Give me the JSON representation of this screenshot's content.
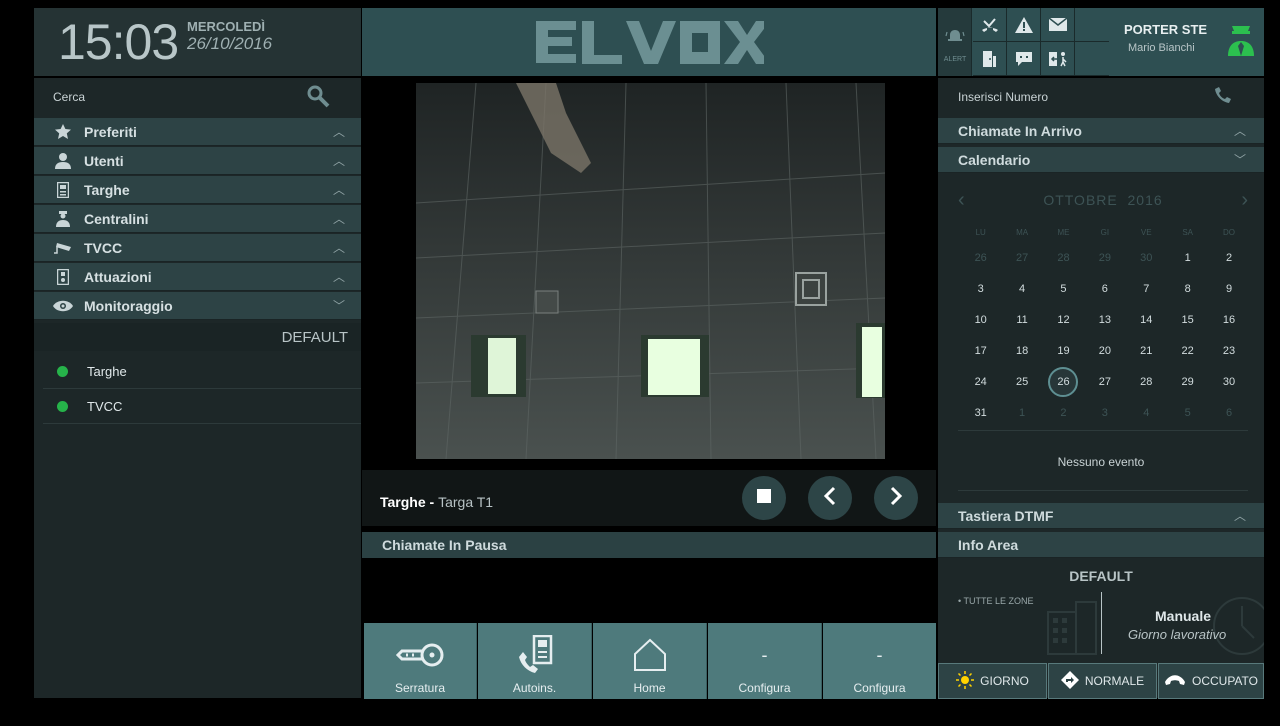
{
  "header": {
    "time": "15:03",
    "day": "MERCOLEDÌ",
    "date": "26/10/2016",
    "logo": "ELVOX",
    "alert_label": "ALERT",
    "role": "PORTER STE",
    "user": "Mario Bianchi"
  },
  "left": {
    "search_placeholder": "Cerca",
    "sections": [
      {
        "label": "Preferiti",
        "icon": "star-icon"
      },
      {
        "label": "Utenti",
        "icon": "user-icon"
      },
      {
        "label": "Targhe",
        "icon": "door-panel-icon"
      },
      {
        "label": "Centralini",
        "icon": "operator-icon"
      },
      {
        "label": "TVCC",
        "icon": "cctv-icon"
      },
      {
        "label": "Attuazioni",
        "icon": "switch-icon"
      },
      {
        "label": "Monitoraggio",
        "icon": "eye-icon"
      }
    ],
    "monitor_group": "DEFAULT",
    "monitor_items": [
      {
        "label": "Targhe",
        "status_color": "#26b34a"
      },
      {
        "label": "TVCC",
        "status_color": "#26b34a"
      }
    ]
  },
  "center": {
    "video_source": "Targhe",
    "video_separator": " - ",
    "video_target": "Targa T1",
    "paused_calls_title": "Chiamate In Pausa",
    "toolbar": [
      {
        "label": "Serratura",
        "icon": "key-icon"
      },
      {
        "label": "Autoins.",
        "icon": "intercom-call-icon"
      },
      {
        "label": "Home",
        "icon": "home-icon"
      },
      {
        "label": "Configura",
        "icon": "-"
      },
      {
        "label": "Configura",
        "icon": "-"
      }
    ]
  },
  "right": {
    "number_placeholder": "Inserisci Numero",
    "incoming_title": "Chiamate In Arrivo",
    "calendar_title": "Calendario",
    "calendar_month": "OTTOBRE",
    "calendar_year": "2016",
    "weekdays": [
      "LU",
      "MA",
      "ME",
      "GI",
      "VE",
      "SA",
      "DO"
    ],
    "days": [
      [
        "26",
        "o"
      ],
      [
        "27",
        "o"
      ],
      [
        "28",
        "o"
      ],
      [
        "29",
        "o"
      ],
      [
        "30",
        "o"
      ],
      [
        "1",
        "c"
      ],
      [
        "2",
        "c"
      ],
      [
        "3",
        "c"
      ],
      [
        "4",
        "c"
      ],
      [
        "5",
        "c"
      ],
      [
        "6",
        "c"
      ],
      [
        "7",
        "c"
      ],
      [
        "8",
        "c"
      ],
      [
        "9",
        "c"
      ],
      [
        "10",
        "c"
      ],
      [
        "11",
        "c"
      ],
      [
        "12",
        "c"
      ],
      [
        "13",
        "c"
      ],
      [
        "14",
        "c"
      ],
      [
        "15",
        "c"
      ],
      [
        "16",
        "c"
      ],
      [
        "17",
        "c"
      ],
      [
        "18",
        "c"
      ],
      [
        "19",
        "c"
      ],
      [
        "20",
        "c"
      ],
      [
        "21",
        "c"
      ],
      [
        "22",
        "c"
      ],
      [
        "23",
        "c"
      ],
      [
        "24",
        "c"
      ],
      [
        "25",
        "c"
      ],
      [
        "26",
        "t"
      ],
      [
        "27",
        "c"
      ],
      [
        "28",
        "c"
      ],
      [
        "29",
        "c"
      ],
      [
        "30",
        "c"
      ],
      [
        "31",
        "c"
      ],
      [
        "1",
        "o"
      ],
      [
        "2",
        "o"
      ],
      [
        "3",
        "o"
      ],
      [
        "4",
        "o"
      ],
      [
        "5",
        "o"
      ],
      [
        "6",
        "o"
      ]
    ],
    "no_event": "Nessuno evento",
    "dtmf_title": "Tastiera DTMF",
    "info_title": "Info Area",
    "info_default": "DEFAULT",
    "zone_label": "• TUTTE LE ZONE",
    "mode_label": "Manuale",
    "mode_sub": "Giorno lavorativo",
    "bottom_buttons": [
      {
        "label": "GIORNO",
        "icon": "sun-icon"
      },
      {
        "label": "NORMALE",
        "icon": "diamond-arrow-icon"
      },
      {
        "label": "OCCUPATO",
        "icon": "hangup-icon"
      }
    ]
  },
  "colors": {
    "accent": "#4e7a7c",
    "header": "#2e4f52",
    "status_green": "#26b34a"
  }
}
